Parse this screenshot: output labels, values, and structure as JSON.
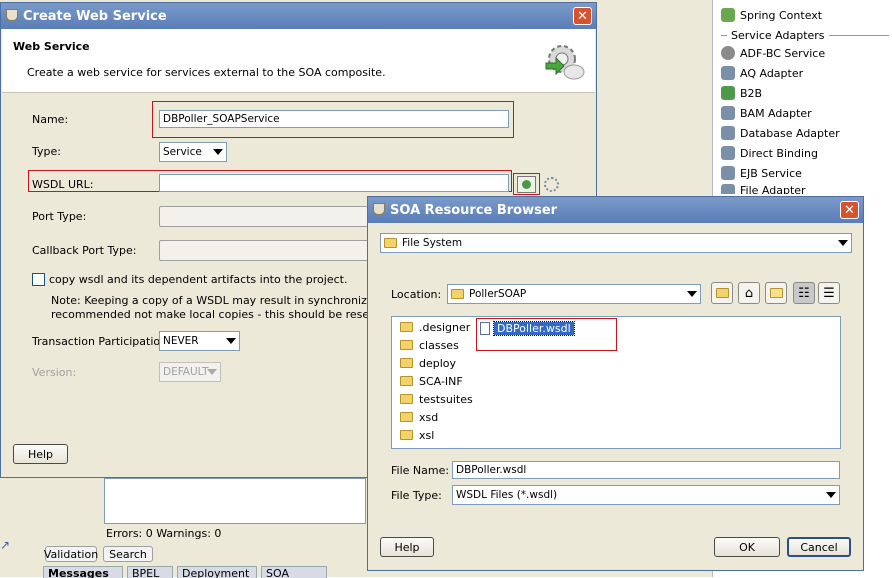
{
  "palette": {
    "items_top": [
      {
        "label": "Spring Context",
        "icon": "spring-context-icon"
      }
    ],
    "section_label": "Service Adapters",
    "items": [
      {
        "label": "ADF-BC Service",
        "icon": "adf-bc-icon"
      },
      {
        "label": "AQ Adapter",
        "icon": "aq-adapter-icon"
      },
      {
        "label": "B2B",
        "icon": "b2b-icon"
      },
      {
        "label": "BAM Adapter",
        "icon": "bam-adapter-icon"
      },
      {
        "label": "Database Adapter",
        "icon": "database-adapter-icon"
      },
      {
        "label": "Direct Binding",
        "icon": "direct-binding-icon"
      },
      {
        "label": "EJB Service",
        "icon": "ejb-service-icon"
      },
      {
        "label": "File Adapter",
        "icon": "file-adapter-icon"
      }
    ]
  },
  "ide_bottom": {
    "errors_text": "Errors: 0 Warnings: 0",
    "buttons": [
      "Validation",
      "Search"
    ],
    "tabs": [
      "Messages",
      "BPEL",
      "Deployment",
      "SOA"
    ]
  },
  "create_ws": {
    "title": "Create Web Service",
    "header_title": "Web Service",
    "header_desc": "Create a web service for services external to the SOA composite.",
    "name_label": "Name:",
    "name_value": "DBPoller_SOAPService",
    "type_label": "Type:",
    "type_value": "Service",
    "wsdl_label": "WSDL URL:",
    "wsdl_value": "",
    "port_type_label": "Port Type:",
    "callback_label": "Callback Port Type:",
    "copy_label": "copy wsdl and its dependent artifacts into the project.",
    "note_line1": "Note: Keeping a copy of a WSDL may result in synchronization issu",
    "note_line2": "recommended not make local copies - this should be reserved for s",
    "transaction_label": "Transaction Participation:",
    "transaction_value": "NEVER",
    "version_label": "Version:",
    "version_value": "DEFAULT",
    "help_label": "Help"
  },
  "browser": {
    "title": "SOA Resource Browser",
    "source_value": "File System",
    "location_label": "Location:",
    "location_value": "PollerSOAP",
    "folders": [
      ".designer",
      "classes",
      "deploy",
      "SCA-INF",
      "testsuites",
      "xsd",
      "xsl"
    ],
    "selected_file": "DBPoller.wsdl",
    "file_name_label": "File Name:",
    "file_name_value": "DBPoller.wsdl",
    "file_type_label": "File Type:",
    "file_type_value": "WSDL Files (*.wsdl)",
    "help_label": "Help",
    "ok_label": "OK",
    "cancel_label": "Cancel"
  },
  "colors": {
    "title_bar": "#5a7db8",
    "highlight_box": "#c8161e",
    "selection": "#316ac5",
    "dialog_bg": "#ece9d8"
  }
}
